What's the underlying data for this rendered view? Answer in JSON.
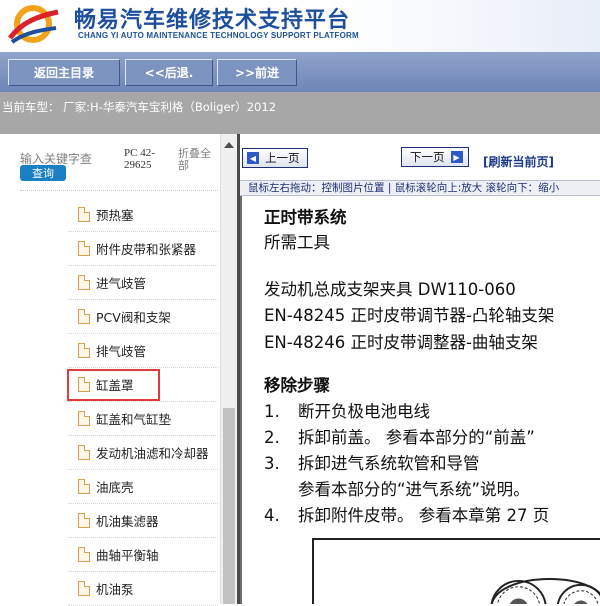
{
  "header": {
    "title_cn": "畅易汽车维修技术支持平台",
    "title_en": "CHANG YI AUTO MAINTENANCE TECHNOLOGY SUPPORT PLATFORM",
    "logo_icon": "swirl-logo-icon"
  },
  "nav": {
    "home": "返回主目录",
    "back": "<<后退.",
    "forward": ">>前进"
  },
  "vehicle": {
    "text": "当前车型：  厂家:H-华泰汽车宝利格（Boliger）2012"
  },
  "search": {
    "placeholder": "输入关键字查",
    "button": "查询",
    "pc": "PC 42-29625",
    "fold": "折叠全部"
  },
  "tree": {
    "items": [
      "预热塞",
      "附件皮带和张紧器",
      "进气歧管",
      "PCV阀和支架",
      "排气歧管",
      "缸盖罩",
      "缸盖和气缸垫",
      "发动机油滤和冷却器",
      "油底壳",
      "机油集滤器",
      "曲轴平衡轴",
      "机油泵"
    ],
    "selected_index": 5
  },
  "viewer": {
    "prev": "上一页",
    "next": "下一页",
    "refresh": "[刷新当前页]",
    "hint": "鼠标左右拖动：控制图片位置 | 鼠标滚轮向上:放大   滚轮向下：缩小"
  },
  "doc": {
    "title": "正时带系统",
    "tools_heading": "所需工具",
    "tools": [
      "发动机总成支架夹具 DW110-060",
      "EN-48245  正时皮带调节器-凸轮轴支架",
      "EN-48246  正时皮带调整器-曲轴支架"
    ],
    "steps_heading": "移除步骤",
    "steps": [
      {
        "n": "1.",
        "text": "断开负极电池电线"
      },
      {
        "n": "2.",
        "text": "拆卸前盖。  参看本部分的“前盖”"
      },
      {
        "n": "3.",
        "text": "拆卸进气系统软管和导管"
      },
      {
        "n": "",
        "text": "参看本部分的“进气系统”说明。"
      },
      {
        "n": "4.",
        "text": "拆卸附件皮带。  参看本章第 27 页"
      }
    ]
  },
  "colors": {
    "brand_blue": "#1d4f9e",
    "nav_bar": "#7d93c0",
    "vehicle_bar": "#a7a7a7",
    "search_button": "#1a7fc3",
    "highlight_red": "#e03a3a"
  }
}
